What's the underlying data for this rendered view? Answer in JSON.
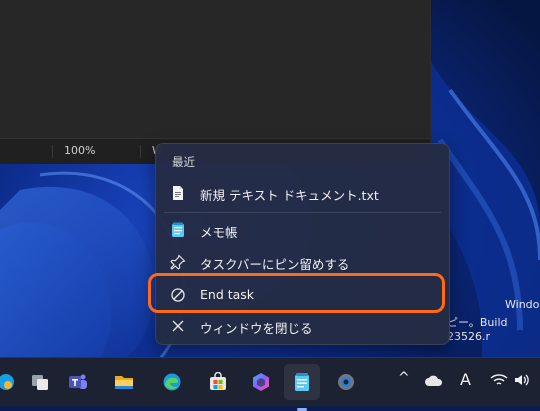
{
  "window": {
    "status_zoom": "100%",
    "status_crop": "W"
  },
  "desktop": {
    "watermark_line1": "Window",
    "watermark_line2": "ピー。Build 23526.r"
  },
  "jumplist": {
    "header": "最近",
    "items": [
      {
        "label": "新規 テキスト ドキュメント.txt",
        "icon": "text-file-icon"
      },
      {
        "label": "メモ帳",
        "icon": "notepad-icon"
      },
      {
        "label": "タスクバーにピン留めする",
        "icon": "pin-icon"
      },
      {
        "label": "End task",
        "icon": "end-task-icon"
      },
      {
        "label": "ウィンドウを閉じる",
        "icon": "close-icon"
      }
    ],
    "highlight_color": "#ff6a13"
  },
  "taskbar": {
    "apps": [
      {
        "name": "edge-partial-icon"
      },
      {
        "name": "task-view-icon"
      },
      {
        "name": "teams-icon"
      },
      {
        "name": "file-explorer-icon"
      },
      {
        "name": "edge-icon"
      },
      {
        "name": "microsoft-store-icon"
      },
      {
        "name": "copilot-icon"
      },
      {
        "name": "notepad-icon"
      },
      {
        "name": "settings-icon"
      }
    ],
    "tray": {
      "chevron": "^",
      "ime": "A"
    }
  }
}
